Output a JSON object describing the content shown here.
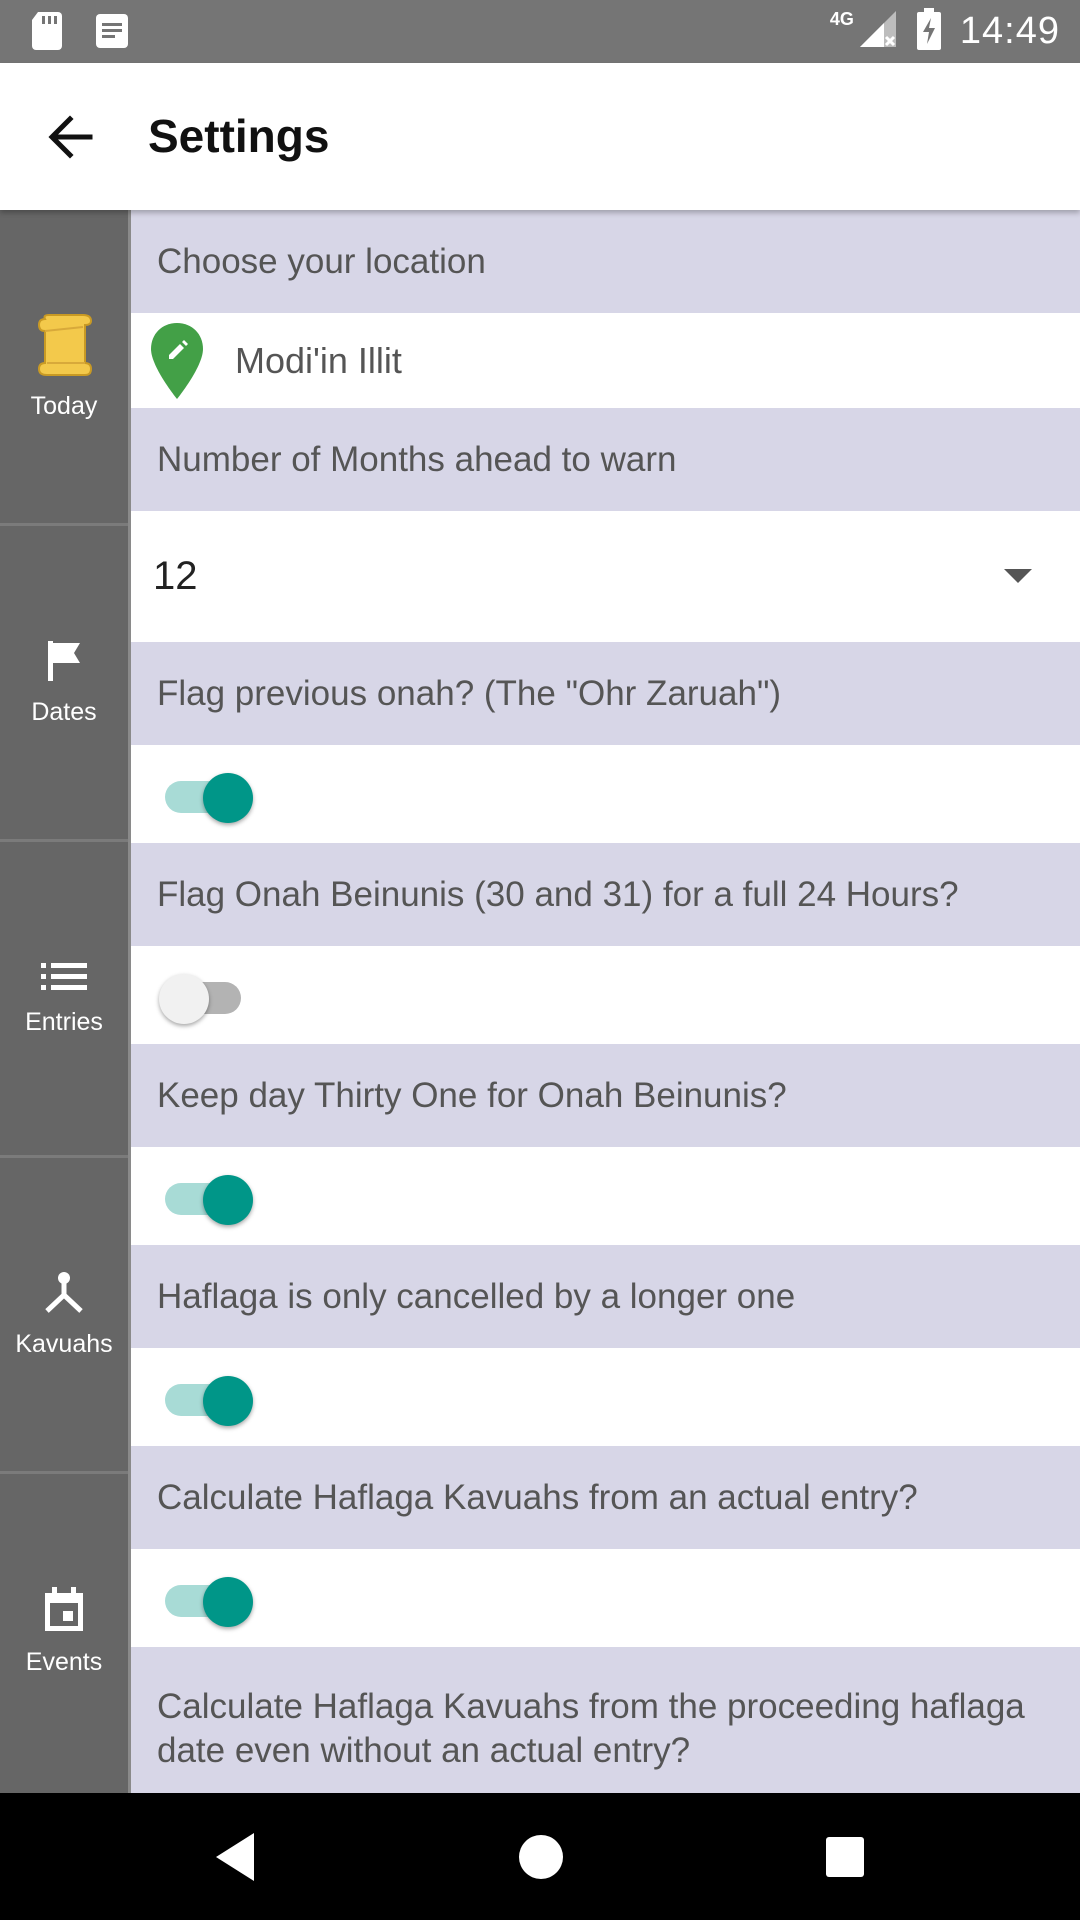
{
  "status_bar": {
    "time": "14:49",
    "network": "4G",
    "icons": [
      "sd-card-icon",
      "notes-icon",
      "signal-icon",
      "battery-charging-icon"
    ]
  },
  "app_bar": {
    "title": "Settings",
    "back_icon": "arrow-back-icon"
  },
  "side_nav": {
    "items": [
      {
        "label": "Today",
        "icon": "scroll-icon"
      },
      {
        "label": "Dates",
        "icon": "flag-icon"
      },
      {
        "label": "Entries",
        "icon": "list-icon"
      },
      {
        "label": "Kavuahs",
        "icon": "merge-icon"
      },
      {
        "label": "Events",
        "icon": "calendar-event-icon"
      }
    ]
  },
  "settings": {
    "location": {
      "label": "Choose your location",
      "value": "Modi'in Illit",
      "icon": "location-edit-icon"
    },
    "months_ahead": {
      "label": "Number of Months ahead to warn",
      "value": "12"
    },
    "toggles": [
      {
        "label": "Flag previous onah? (The \"Ohr Zaruah\")",
        "on": true
      },
      {
        "label": "Flag Onah Beinunis (30 and 31) for a full 24 Hours?",
        "on": false
      },
      {
        "label": "Keep day Thirty One for Onah Beinunis?",
        "on": true
      },
      {
        "label": "Haflaga is only cancelled by a longer one",
        "on": true
      },
      {
        "label": "Calculate Haflaga Kavuahs from an actual entry?",
        "on": true
      }
    ],
    "last_label": "Calculate Haflaga Kavuahs from the proceeding haflaga date even without an actual entry?"
  },
  "colors": {
    "accent": "#009688",
    "accent_track": "#a8dbd6",
    "label_bg": "#d7d6e7",
    "side_nav_bg": "#666666",
    "location_pin": "#43a047"
  },
  "system_nav": {
    "buttons": [
      "back-triangle-icon",
      "home-circle-icon",
      "recents-square-icon"
    ]
  }
}
